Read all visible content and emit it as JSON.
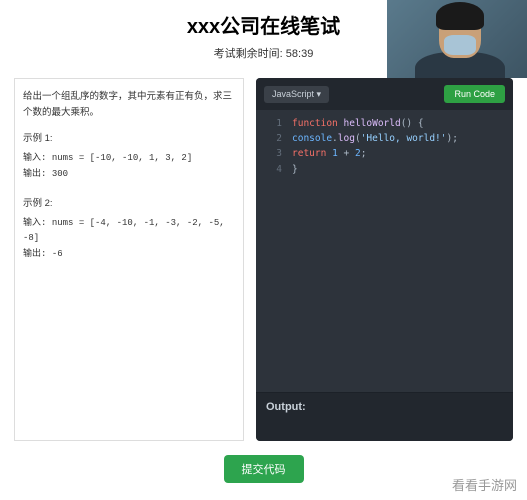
{
  "header": {
    "title": "xxx公司在线笔试",
    "timer_prefix": "考试剩余时间: ",
    "timer_value": "58:39"
  },
  "problem": {
    "statement": "给出一个组乱序的数字，其中元素有正有负，求三个数的最大乘积。",
    "examples": [
      {
        "label": "示例 1:",
        "input_label": "输入: ",
        "input_value": "nums = [-10, -10, 1, 3, 2]",
        "output_label": "输出: ",
        "output_value": "300"
      },
      {
        "label": "示例 2:",
        "input_label": "输入: ",
        "input_value": "nums = [-4, -10, -1, -3, -2, -5, -8]",
        "output_label": "输出: ",
        "output_value": "-6"
      }
    ]
  },
  "editor": {
    "language": "JavaScript",
    "run_label": "Run Code",
    "code_lines": [
      {
        "num": "1",
        "parts": [
          {
            "t": "function",
            "c": "kw"
          },
          {
            "t": " ",
            "c": ""
          },
          {
            "t": "helloWorld",
            "c": "fn"
          },
          {
            "t": "() {",
            "c": "brace"
          }
        ]
      },
      {
        "num": "2",
        "parts": [
          {
            "t": "    ",
            "c": ""
          },
          {
            "t": "console",
            "c": "method"
          },
          {
            "t": ".",
            "c": "dot-sep"
          },
          {
            "t": "log",
            "c": "fn"
          },
          {
            "t": "(",
            "c": "brace"
          },
          {
            "t": "'Hello, world!'",
            "c": "str"
          },
          {
            "t": ");",
            "c": "brace"
          }
        ]
      },
      {
        "num": "3",
        "parts": [
          {
            "t": "    ",
            "c": ""
          },
          {
            "t": "return",
            "c": "kw"
          },
          {
            "t": " ",
            "c": ""
          },
          {
            "t": "1",
            "c": "num"
          },
          {
            "t": " + ",
            "c": ""
          },
          {
            "t": "2",
            "c": "num"
          },
          {
            "t": ";",
            "c": "brace"
          }
        ]
      },
      {
        "num": "4",
        "parts": [
          {
            "t": "}",
            "c": "brace"
          }
        ]
      }
    ],
    "output_label": "Output:"
  },
  "footer": {
    "submit_label": "提交代码"
  },
  "watermark": "看看手游网"
}
